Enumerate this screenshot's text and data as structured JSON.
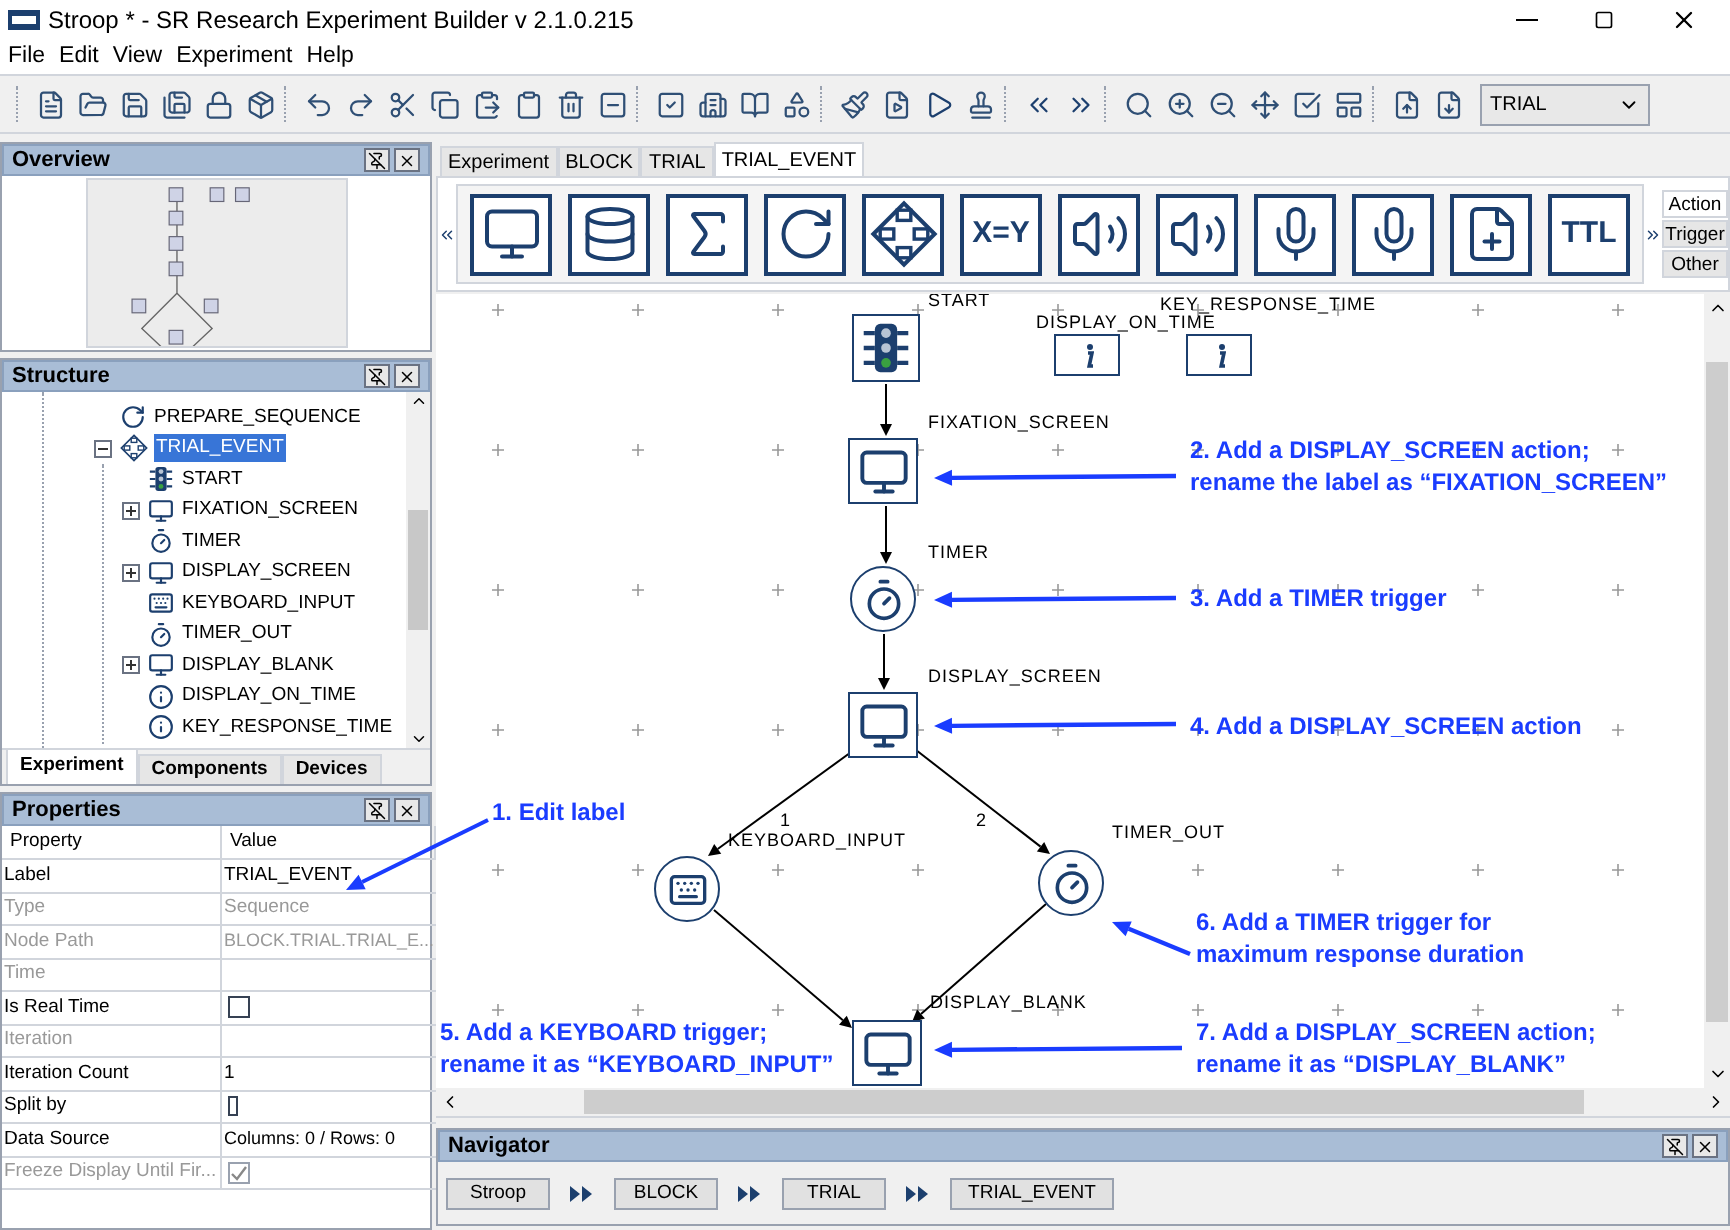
{
  "window": {
    "title": "Stroop * - SR Research Experiment Builder v 2.1.0.215"
  },
  "menu": [
    "File",
    "Edit",
    "View",
    "Experiment",
    "Help"
  ],
  "toolbar": {
    "dropdown": "TRIAL"
  },
  "overview": {
    "title": "Overview"
  },
  "structure": {
    "title": "Structure",
    "items": [
      {
        "label": "PREPARE_SEQUENCE",
        "kind": "prepare",
        "selected": false
      },
      {
        "label": "TRIAL_EVENT",
        "kind": "sequence",
        "selected": true,
        "expanded": true,
        "children": [
          {
            "label": "START",
            "kind": "start",
            "selected": false
          },
          {
            "label": "FIXATION_SCREEN",
            "kind": "display",
            "selected": false,
            "expanded": false
          },
          {
            "label": "TIMER",
            "kind": "timer",
            "selected": false
          },
          {
            "label": "DISPLAY_SCREEN",
            "kind": "display",
            "selected": false,
            "expanded": false
          },
          {
            "label": "KEYBOARD_INPUT",
            "kind": "keyboard",
            "selected": false
          },
          {
            "label": "TIMER_OUT",
            "kind": "timer",
            "selected": false
          },
          {
            "label": "DISPLAY_BLANK",
            "kind": "display",
            "selected": false,
            "expanded": false
          },
          {
            "label": "DISPLAY_ON_TIME",
            "kind": "info",
            "selected": false
          },
          {
            "label": "KEY_RESPONSE_TIME",
            "kind": "info",
            "selected": false
          }
        ]
      }
    ],
    "tabs": [
      {
        "label": "Experiment",
        "selected": true
      },
      {
        "label": "Components",
        "selected": false
      },
      {
        "label": "Devices",
        "selected": false
      }
    ]
  },
  "properties": {
    "title": "Properties",
    "columns": [
      "Property",
      "Value"
    ],
    "rows": [
      {
        "property": "Label",
        "kind": "text",
        "value": "TRIAL_EVENT",
        "disabled": false
      },
      {
        "property": "Type",
        "kind": "text",
        "value": "Sequence",
        "disabled": true
      },
      {
        "property": "Node Path",
        "kind": "text",
        "value": "BLOCK.TRIAL.TRIAL_E...",
        "disabled": true
      },
      {
        "property": "Time",
        "kind": "text",
        "disabled": true
      },
      {
        "property": "Is Real Time",
        "kind": "checkbox",
        "checked": false,
        "disabled": false
      },
      {
        "property": "Iteration",
        "kind": "text",
        "disabled": true
      },
      {
        "property": "Iteration Count",
        "kind": "text",
        "value": "1",
        "disabled": false
      },
      {
        "property": "Split by",
        "kind": "picker",
        "disabled": false
      },
      {
        "property": "Data Source",
        "kind": "text",
        "value": "Columns: 0 / Rows: 0",
        "disabled": false
      },
      {
        "property": "Freeze Display Until Fir...",
        "kind": "checkbox",
        "checked": true,
        "disabled": true
      }
    ]
  },
  "editor_tabs": [
    {
      "label": "Experiment",
      "selected": false
    },
    {
      "label": "BLOCK",
      "selected": false
    },
    {
      "label": "TRIAL",
      "selected": false
    },
    {
      "label": "TRIAL_EVENT",
      "selected": true
    }
  ],
  "palette": {
    "items": [
      {
        "kind": "display"
      },
      {
        "kind": "database"
      },
      {
        "kind": "sum"
      },
      {
        "kind": "loop"
      },
      {
        "kind": "sequence"
      },
      {
        "kind": "text",
        "text": "X=Y"
      },
      {
        "kind": "sound"
      },
      {
        "kind": "sound-play"
      },
      {
        "kind": "record"
      },
      {
        "kind": "record-play"
      },
      {
        "kind": "add-list"
      },
      {
        "kind": "ttl",
        "text": "TTL"
      }
    ],
    "side_tabs": [
      {
        "label": "Action",
        "selected": true
      },
      {
        "label": "Trigger",
        "selected": false
      },
      {
        "label": "Other",
        "selected": false
      }
    ]
  },
  "canvas": {
    "nodes": [
      {
        "label": "START",
        "kind": "start"
      },
      {
        "label": "DISPLAY_ON_TIME",
        "kind": "info"
      },
      {
        "label": "KEY_RESPONSE_TIME",
        "kind": "info"
      },
      {
        "label": "FIXATION_SCREEN",
        "kind": "display"
      },
      {
        "label": "TIMER",
        "kind": "timer"
      },
      {
        "label": "DISPLAY_SCREEN",
        "kind": "display"
      },
      {
        "label": "KEYBOARD_INPUT",
        "kind": "keyboard"
      },
      {
        "label": "TIMER_OUT",
        "kind": "timer"
      },
      {
        "label": "DISPLAY_BLANK",
        "kind": "display"
      }
    ],
    "edge_labels": [
      "1",
      "2"
    ],
    "annotations": [
      {
        "lines": [
          "1. Edit label"
        ]
      },
      {
        "lines": [
          "2. Add a DISPLAY_SCREEN action;",
          "rename the label as “FIXATION_SCREEN”"
        ]
      },
      {
        "lines": [
          "3. Add a TIMER trigger"
        ]
      },
      {
        "lines": [
          "4. Add a DISPLAY_SCREEN action"
        ]
      },
      {
        "lines": [
          "5. Add a KEYBOARD trigger;",
          "rename it as “KEYBOARD_INPUT”"
        ]
      },
      {
        "lines": [
          "6. Add a TIMER trigger for",
          "maximum response duration"
        ]
      },
      {
        "lines": [
          "7. Add a DISPLAY_SCREEN action;",
          "rename it as “DISPLAY_BLANK”"
        ]
      }
    ]
  },
  "navigator": {
    "title": "Navigator",
    "path": [
      "Stroop",
      "BLOCK",
      "TRIAL",
      "TRIAL_EVENT"
    ]
  }
}
